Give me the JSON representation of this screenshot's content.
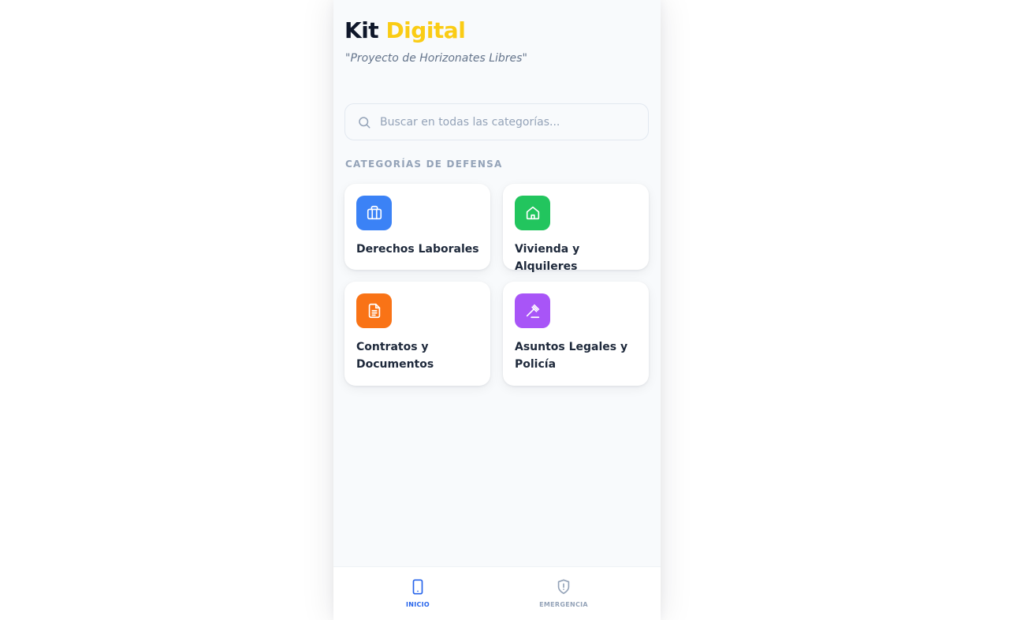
{
  "app": {
    "title_main": "Kit",
    "title_accent": "Digital",
    "subtitle": "\"Proyecto de Horizonates Libres\""
  },
  "search": {
    "placeholder": "Buscar en todas las categorías...",
    "icon": "search-icon"
  },
  "section": {
    "label": "CATEGORÍAS DE DEFENSA"
  },
  "categories": [
    {
      "label": "Derechos Laborales",
      "icon": "briefcase-icon",
      "color": "#3b82f6"
    },
    {
      "label": "Vivienda y Alquileres",
      "icon": "home-icon",
      "color": "#22c55e"
    },
    {
      "label": "Contratos y Documentos",
      "icon": "document-icon",
      "color": "#f97316"
    },
    {
      "label": "Asuntos Legales y Policía",
      "icon": "gavel-icon",
      "color": "#a855f7"
    }
  ],
  "nav": {
    "items": [
      {
        "label": "INICIO",
        "icon": "phone-icon",
        "active": true,
        "color": "#2563eb"
      },
      {
        "label": "EMERGENCIA",
        "icon": "shield-alert-icon",
        "active": false,
        "color": "#94a3b8"
      }
    ]
  },
  "colors": {
    "accent": "#facc15",
    "background": "#f8fafc",
    "text_dark": "#0f172a"
  }
}
